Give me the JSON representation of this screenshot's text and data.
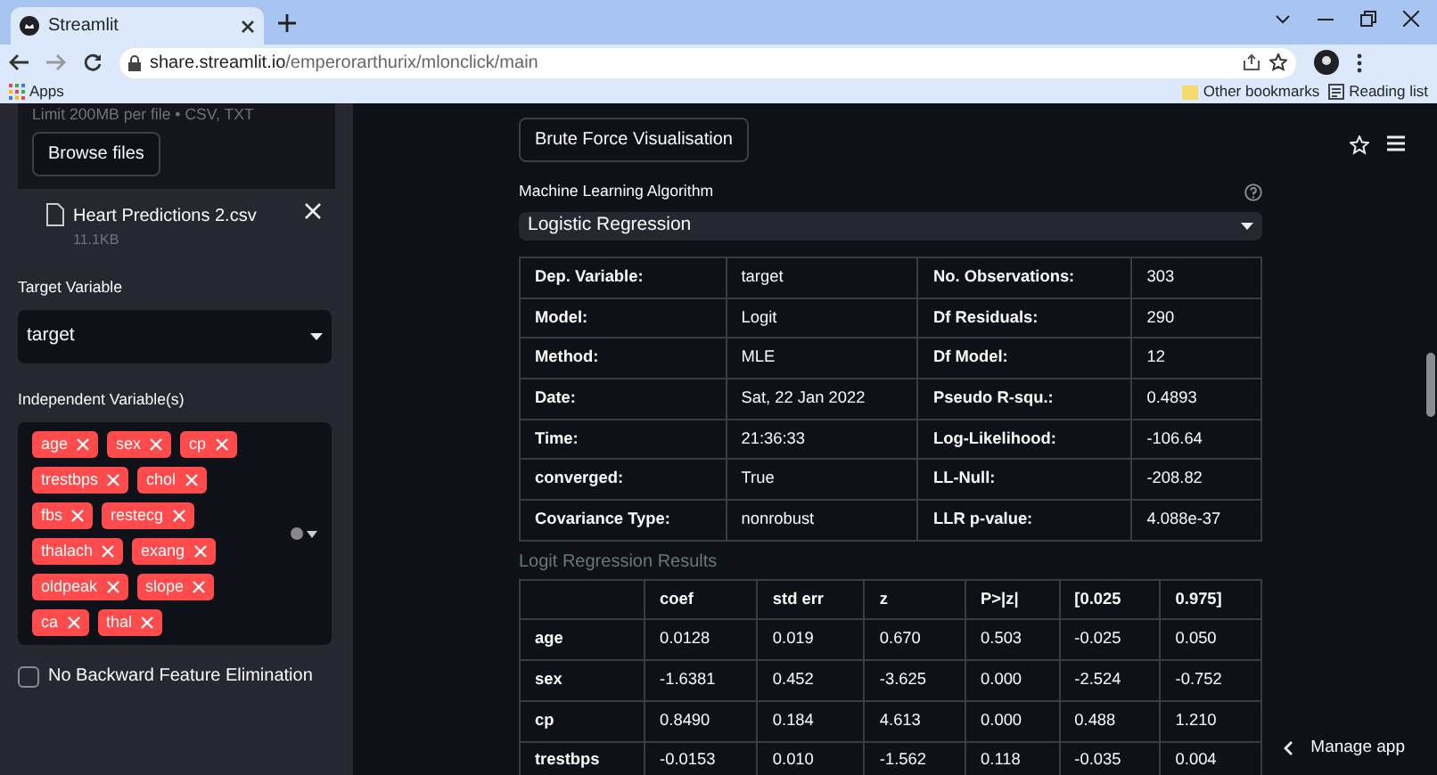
{
  "browser": {
    "tab_title": "Streamlit",
    "address_host": "share.streamlit.io",
    "address_path": "/emperorarthurix/mlonclick/main",
    "bookmarks": [
      {
        "label": "Apps",
        "kind": "apps"
      },
      {
        "label": "Other bookmarks",
        "kind": "folder"
      },
      {
        "label": "Reading list",
        "kind": "reading"
      }
    ]
  },
  "sidebar": {
    "upload_hint": "Limit 200MB per file • CSV, TXT",
    "browse_button": "Browse files",
    "file": {
      "name": "Heart Predictions 2.csv",
      "size": "11.1KB"
    },
    "target": {
      "label": "Target Variable",
      "value": "target"
    },
    "independent": {
      "label": "Independent Variable(s)",
      "tags": [
        [
          "age",
          "sex",
          "cp"
        ],
        [
          "trestbps",
          "chol"
        ],
        [
          "fbs",
          "restecg"
        ],
        [
          "thalach",
          "exang"
        ],
        [
          "oldpeak",
          "slope"
        ],
        [
          "ca",
          "thal"
        ]
      ]
    },
    "checkbox": {
      "label": "No Backward Feature Elimination",
      "checked": false
    }
  },
  "main": {
    "button": "Brute Force Visualisation",
    "algorithm": {
      "label": "Machine Learning Algorithm",
      "value": "Logistic Regression"
    },
    "summary_rows": [
      [
        "Dep. Variable:",
        "target",
        "No. Observations:",
        "303"
      ],
      [
        "Model:",
        "Logit",
        "Df Residuals:",
        "290"
      ],
      [
        "Method:",
        "MLE",
        "Df Model:",
        "12"
      ],
      [
        "Date:",
        "Sat, 22 Jan 2022",
        "Pseudo R-squ.:",
        "0.4893"
      ],
      [
        "Time:",
        "21:36:33",
        "Log-Likelihood:",
        "-106.64"
      ],
      [
        "converged:",
        "True",
        "LL-Null:",
        "-208.82"
      ],
      [
        "Covariance Type:",
        "nonrobust",
        "LLR p-value:",
        "4.088e-37"
      ]
    ],
    "caption": "Logit Regression Results",
    "coef_columns": [
      "coef",
      "std err",
      "z",
      "P>|z|",
      "[0.025",
      "0.975]"
    ],
    "coef_rows": [
      [
        "age",
        "0.0128",
        "0.019",
        "0.670",
        "0.503",
        "-0.025",
        "0.050"
      ],
      [
        "sex",
        "-1.6381",
        "0.452",
        "-3.625",
        "0.000",
        "-2.524",
        "-0.752"
      ],
      [
        "cp",
        "0.8490",
        "0.184",
        "4.613",
        "0.000",
        "0.488",
        "1.210"
      ],
      [
        "trestbps",
        "-0.0153",
        "0.010",
        "-1.562",
        "0.118",
        "-0.035",
        "0.004"
      ]
    ],
    "manage_app": "Manage app"
  }
}
